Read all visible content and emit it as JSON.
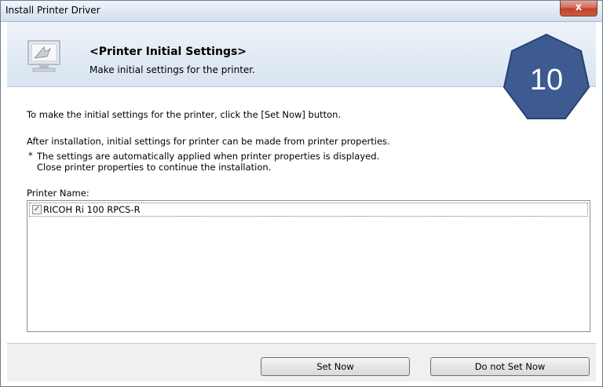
{
  "window": {
    "title": "Install Printer Driver",
    "close_glyph": "x"
  },
  "header": {
    "title": "<Printer Initial Settings>",
    "subtitle": "Make initial settings for the printer.",
    "icon": "computer-setup-icon"
  },
  "content": {
    "line1": "To make the initial settings for the printer, click the [Set Now] button.",
    "line2": "After installation, initial settings for printer can be made from printer properties.",
    "note_star": "*",
    "note_line1": "The settings are automatically applied when printer properties is displayed.",
    "note_line2": "Close printer properties to continue the installation.",
    "printer_name_label": "Printer Name:",
    "printers": [
      {
        "name": "RICOH Ri 100 RPCS-R",
        "checked": true
      }
    ]
  },
  "buttons": {
    "set_now": "Set Now",
    "do_not_set_now": "Do not Set Now"
  },
  "step_badge": {
    "number": "10",
    "color": "#3d5a91"
  }
}
